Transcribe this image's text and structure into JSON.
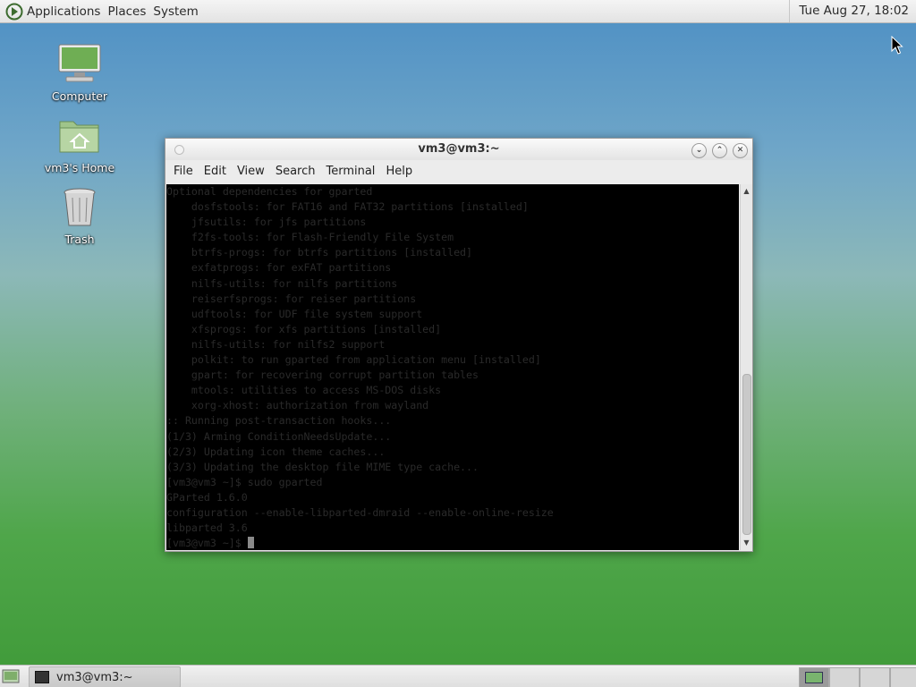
{
  "top_panel": {
    "menus": [
      "Applications",
      "Places",
      "System"
    ],
    "clock": "Tue Aug 27, 18:02"
  },
  "desktop": {
    "icons": [
      {
        "label": "Computer",
        "icon": "computer-icon"
      },
      {
        "label": "vm3's Home",
        "icon": "home-folder-icon"
      },
      {
        "label": "Trash",
        "icon": "trash-icon"
      }
    ]
  },
  "window": {
    "title": "vm3@vm3:~",
    "menus": [
      "File",
      "Edit",
      "View",
      "Search",
      "Terminal",
      "Help"
    ],
    "terminal_lines": [
      "Optional dependencies for gparted",
      "    dosfstools: for FAT16 and FAT32 partitions [installed]",
      "    jfsutils: for jfs partitions",
      "    f2fs-tools: for Flash-Friendly File System",
      "    btrfs-progs: for btrfs partitions [installed]",
      "    exfatprogs: for exFAT partitions",
      "    nilfs-utils: for nilfs partitions",
      "    reiserfsprogs: for reiser partitions",
      "    udftools: for UDF file system support",
      "    xfsprogs: for xfs partitions [installed]",
      "    nilfs-utils: for nilfs2 support",
      "    polkit: to run gparted from application menu [installed]",
      "    gpart: for recovering corrupt partition tables",
      "    mtools: utilities to access MS-DOS disks",
      "    xorg-xhost: authorization from wayland",
      ":: Running post-transaction hooks...",
      "(1/3) Arming ConditionNeedsUpdate...",
      "(2/3) Updating icon theme caches...",
      "(3/3) Updating the desktop file MIME type cache...",
      "[vm3@vm3 ~]$ sudo gparted",
      "GParted 1.6.0",
      "configuration --enable-libparted-dmraid --enable-online-resize",
      "libparted 3.6",
      "[vm3@vm3 ~]$ "
    ]
  },
  "taskbar": {
    "task_label": "vm3@vm3:~",
    "workspaces": 4,
    "active_workspace": 1
  },
  "colors": {
    "terminal_bg": "#000000",
    "terminal_text": "#2a2a2a",
    "panel": "#e8e8e8"
  }
}
